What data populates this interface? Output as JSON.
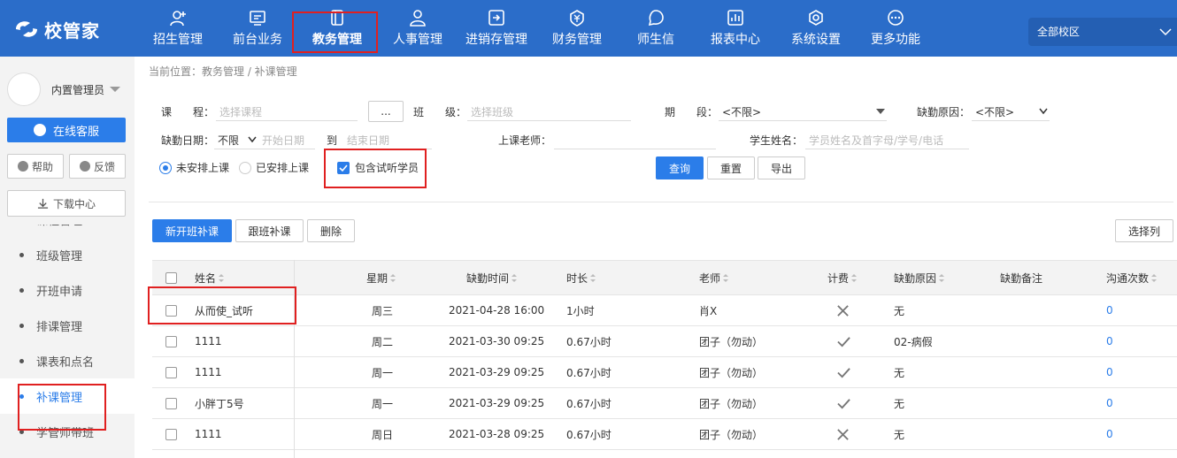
{
  "app": {
    "logo_text": "校管家",
    "campus": "全部校区"
  },
  "nav": [
    {
      "label": "招生管理",
      "icon": "user-plus-icon"
    },
    {
      "label": "前台业务",
      "icon": "monitor-icon"
    },
    {
      "label": "教务管理",
      "icon": "book-icon"
    },
    {
      "label": "人事管理",
      "icon": "person-icon"
    },
    {
      "label": "进销存管理",
      "icon": "inbox-arrow-icon"
    },
    {
      "label": "财务管理",
      "icon": "yen-shield-icon"
    },
    {
      "label": "师生信",
      "icon": "chat-icon"
    },
    {
      "label": "报表中心",
      "icon": "chart-icon"
    },
    {
      "label": "系统设置",
      "icon": "gear-icon"
    },
    {
      "label": "更多功能",
      "icon": "more-icon"
    }
  ],
  "sidebar": {
    "user_name": "内置管理员",
    "online_service": "在线客服",
    "help": "帮助",
    "feedback": "反馈",
    "download": "下载中心",
    "menu": [
      "课程管理",
      "班级管理",
      "开班申请",
      "排课管理",
      "课表和点名",
      "补课管理",
      "学管师带班"
    ],
    "active_index": 5
  },
  "breadcrumb": "当前位置：教务管理 / 补课管理",
  "filters": {
    "course_label": "课　　程：",
    "course_placeholder": "选择课程",
    "course_btn": "...",
    "class_label": "班　　级：",
    "class_placeholder": "选择班级",
    "period_label": "期　　段：",
    "period_value": "<不限>",
    "reason_label": "缺勤原因：",
    "reason_value": "<不限>",
    "date_label": "缺勤日期：",
    "date_mode": "不限",
    "date_start": "开始日期",
    "date_to": "到",
    "date_end": "结束日期",
    "teacher_label": "上课老师：",
    "student_label": "学生姓名：",
    "student_placeholder": "学员姓名及首字母/学号/电话",
    "radio_unscheduled": "未安排上课",
    "radio_scheduled": "已安排上课",
    "include_trial": "包含试听学员",
    "query": "查询",
    "reset": "重置",
    "export": "导出"
  },
  "actions": {
    "new_class": "新开班补课",
    "follow_class": "跟班补课",
    "delete": "删除",
    "choose_cols": "选择列"
  },
  "table": {
    "headers": {
      "name": "姓名",
      "week": "星期",
      "time": "缺勤时间",
      "duration": "时长",
      "teacher": "老师",
      "charge": "计费",
      "reason": "缺勤原因",
      "remark": "缺勤备注",
      "comm": "沟通次数"
    },
    "rows": [
      {
        "name": "从而使_试听",
        "week": "周三",
        "time": "2021-04-28 16:00",
        "duration": "1小时",
        "teacher": "肖X",
        "charge": "no",
        "reason": "无",
        "comm": "0"
      },
      {
        "name": "1111",
        "week": "周二",
        "time": "2021-03-30 09:25",
        "duration": "0.67小时",
        "teacher": "团子（勿动）",
        "charge": "yes",
        "reason": "02-病假",
        "comm": "0"
      },
      {
        "name": "1111",
        "week": "周一",
        "time": "2021-03-29 09:25",
        "duration": "0.67小时",
        "teacher": "团子（勿动）",
        "charge": "yes",
        "reason": "无",
        "comm": "0"
      },
      {
        "name": "小胖丁5号",
        "week": "周一",
        "time": "2021-03-29 09:25",
        "duration": "0.67小时",
        "teacher": "团子（勿动）",
        "charge": "yes",
        "reason": "无",
        "comm": "0"
      },
      {
        "name": "1111",
        "week": "周日",
        "time": "2021-03-28 09:25",
        "duration": "0.67小时",
        "teacher": "团子（勿动）",
        "charge": "no",
        "reason": "无",
        "comm": "0"
      }
    ]
  },
  "colors": {
    "primary": "#2b7de9",
    "header_bg": "#2b6dc9",
    "highlight": "#e02020"
  }
}
